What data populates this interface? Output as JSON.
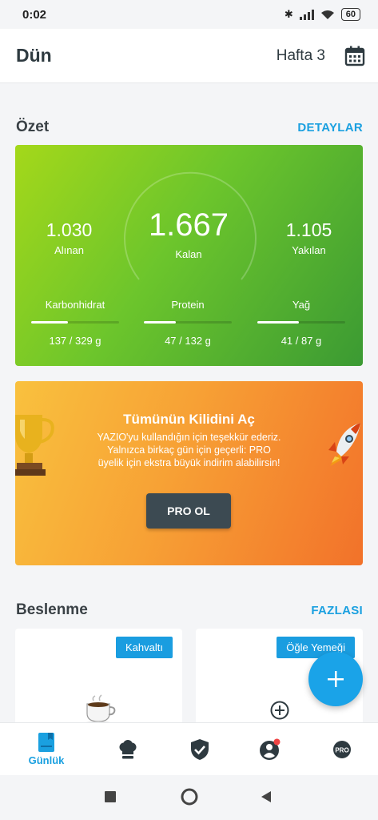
{
  "status": {
    "time": "0:02",
    "battery": "60"
  },
  "header": {
    "title": "Dün",
    "week": "Hafta 3"
  },
  "summary": {
    "title": "Özet",
    "link": "DETAYLAR",
    "eaten": {
      "value": "1.030",
      "label": "Alınan"
    },
    "remaining": {
      "value": "1.667",
      "label": "Kalan"
    },
    "burned": {
      "value": "1.105",
      "label": "Yakılan"
    },
    "macros": [
      {
        "name": "Karbonhidrat",
        "value": "137 / 329 g",
        "progress": 0.42
      },
      {
        "name": "Protein",
        "value": "47 / 132 g",
        "progress": 0.36
      },
      {
        "name": "Yağ",
        "value": "41 / 87 g",
        "progress": 0.47
      }
    ]
  },
  "promo": {
    "title": "Tümünün Kilidini Aç",
    "line1": "YAZIO'yu kullandığın için teşekkür ederiz.",
    "line2": "Yalnızca birkaç gün için geçerli: PRO",
    "line3": "üyelik için ekstra büyük indirim alabilirsin!",
    "button": "PRO OL"
  },
  "nutrition": {
    "title": "Beslenme",
    "link": "FAZLASI",
    "meals": [
      {
        "tag": "Kahvaltı"
      },
      {
        "tag": "Öğle Yemeği"
      }
    ]
  },
  "nav": {
    "diary": "Günlük",
    "pro_badge": "PRO"
  },
  "colors": {
    "accent": "#1aa0e0",
    "summary_start": "#a4d81a",
    "summary_end": "#3b9a33",
    "promo_start": "#f9c13e",
    "promo_end": "#f2722a"
  }
}
